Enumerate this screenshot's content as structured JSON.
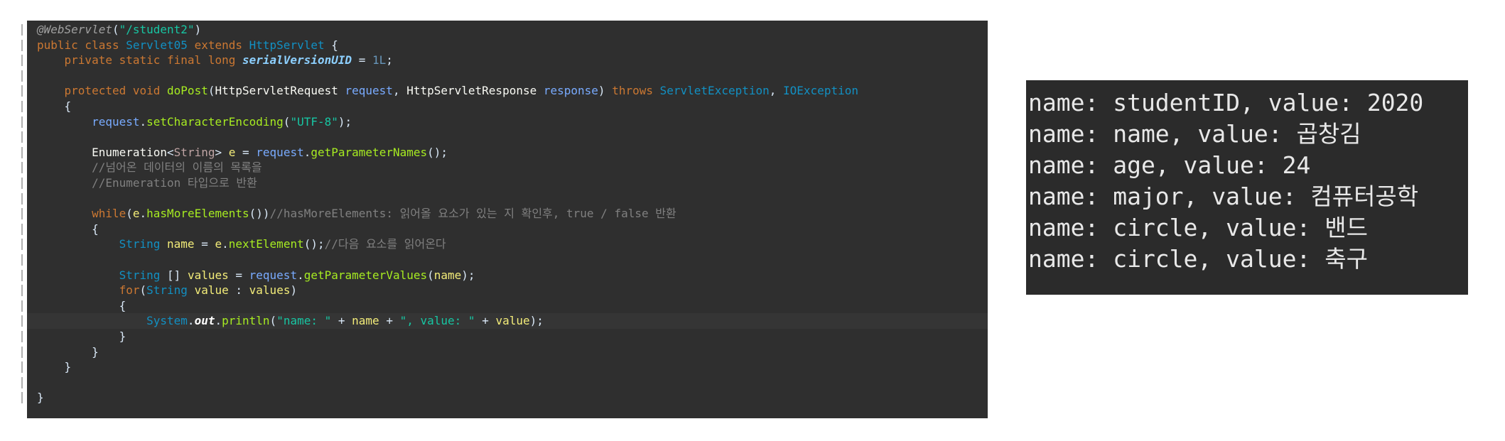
{
  "editor": {
    "lines": [
      {
        "segments": [
          {
            "c": "t-ann",
            "t": "@WebServlet"
          },
          {
            "c": "t-plain",
            "t": "("
          },
          {
            "c": "t-str",
            "t": "\"/student2\""
          },
          {
            "c": "t-plain",
            "t": ")"
          }
        ]
      },
      {
        "segments": [
          {
            "c": "t-kw",
            "t": "public class "
          },
          {
            "c": "t-cls",
            "t": "Servlet05"
          },
          {
            "c": "t-kw",
            "t": " extends "
          },
          {
            "c": "t-cls",
            "t": "HttpServlet"
          },
          {
            "c": "t-plain",
            "t": " {"
          }
        ]
      },
      {
        "segments": [
          {
            "c": "t-kw",
            "t": "    private static final long "
          },
          {
            "c": "t-field",
            "t": "serialVersionUID"
          },
          {
            "c": "t-plain",
            "t": " = "
          },
          {
            "c": "t-num",
            "t": "1L"
          },
          {
            "c": "t-plain",
            "t": ";"
          }
        ]
      },
      {
        "segments": []
      },
      {
        "segments": [
          {
            "c": "t-kw",
            "t": "    protected void "
          },
          {
            "c": "t-meth",
            "t": "doPost"
          },
          {
            "c": "t-plain",
            "t": "("
          },
          {
            "c": "t-type",
            "t": "HttpServletRequest "
          },
          {
            "c": "t-param",
            "t": "request"
          },
          {
            "c": "t-plain",
            "t": ", "
          },
          {
            "c": "t-type",
            "t": "HttpServletResponse "
          },
          {
            "c": "t-param",
            "t": "response"
          },
          {
            "c": "t-plain",
            "t": ") "
          },
          {
            "c": "t-kw",
            "t": "throws "
          },
          {
            "c": "t-cls",
            "t": "ServletException"
          },
          {
            "c": "t-plain",
            "t": ", "
          },
          {
            "c": "t-cls",
            "t": "IOException"
          }
        ]
      },
      {
        "segments": [
          {
            "c": "t-plain",
            "t": "    {"
          }
        ]
      },
      {
        "segments": [
          {
            "c": "t-param",
            "t": "        request"
          },
          {
            "c": "t-plain",
            "t": "."
          },
          {
            "c": "t-mcall",
            "t": "setCharacterEncoding"
          },
          {
            "c": "t-plain",
            "t": "("
          },
          {
            "c": "t-str",
            "t": "\"UTF-8\""
          },
          {
            "c": "t-plain",
            "t": ");"
          }
        ]
      },
      {
        "segments": []
      },
      {
        "segments": [
          {
            "c": "t-type",
            "t": "        Enumeration"
          },
          {
            "c": "t-plain",
            "t": "<"
          },
          {
            "c": "t-gen",
            "t": "String"
          },
          {
            "c": "t-plain",
            "t": "> "
          },
          {
            "c": "t-var",
            "t": "e"
          },
          {
            "c": "t-plain",
            "t": " = "
          },
          {
            "c": "t-param",
            "t": "request"
          },
          {
            "c": "t-plain",
            "t": "."
          },
          {
            "c": "t-mcall",
            "t": "getParameterNames"
          },
          {
            "c": "t-plain",
            "t": "();"
          }
        ]
      },
      {
        "segments": [
          {
            "c": "t-com",
            "t": "        //넘어온 데이터의 이름의 목록을"
          }
        ]
      },
      {
        "segments": [
          {
            "c": "t-com",
            "t": "        //Enumeration 타입으로 반환"
          }
        ]
      },
      {
        "segments": []
      },
      {
        "segments": [
          {
            "c": "t-kw",
            "t": "        while"
          },
          {
            "c": "t-plain",
            "t": "("
          },
          {
            "c": "t-var",
            "t": "e"
          },
          {
            "c": "t-plain",
            "t": "."
          },
          {
            "c": "t-mcall",
            "t": "hasMoreElements"
          },
          {
            "c": "t-plain",
            "t": "())"
          },
          {
            "c": "t-com",
            "t": "//hasMoreElements: 읽어올 요소가 있는 지 확인후, true / false 반환"
          }
        ]
      },
      {
        "segments": [
          {
            "c": "t-plain",
            "t": "        {"
          }
        ]
      },
      {
        "segments": [
          {
            "c": "t-cls",
            "t": "            String "
          },
          {
            "c": "t-var",
            "t": "name"
          },
          {
            "c": "t-plain",
            "t": " = "
          },
          {
            "c": "t-var",
            "t": "e"
          },
          {
            "c": "t-plain",
            "t": "."
          },
          {
            "c": "t-mcall",
            "t": "nextElement"
          },
          {
            "c": "t-plain",
            "t": "();"
          },
          {
            "c": "t-com",
            "t": "//다음 요소를 읽어온다"
          }
        ]
      },
      {
        "segments": []
      },
      {
        "segments": [
          {
            "c": "t-cls",
            "t": "            String "
          },
          {
            "c": "t-plain",
            "t": "[] "
          },
          {
            "c": "t-var",
            "t": "values"
          },
          {
            "c": "t-plain",
            "t": " = "
          },
          {
            "c": "t-param",
            "t": "request"
          },
          {
            "c": "t-plain",
            "t": "."
          },
          {
            "c": "t-mcall",
            "t": "getParameterValues"
          },
          {
            "c": "t-plain",
            "t": "("
          },
          {
            "c": "t-var",
            "t": "name"
          },
          {
            "c": "t-plain",
            "t": ");"
          }
        ]
      },
      {
        "segments": [
          {
            "c": "t-kw",
            "t": "            for"
          },
          {
            "c": "t-plain",
            "t": "("
          },
          {
            "c": "t-cls",
            "t": "String "
          },
          {
            "c": "t-var",
            "t": "value"
          },
          {
            "c": "t-plain",
            "t": " : "
          },
          {
            "c": "t-var",
            "t": "values"
          },
          {
            "c": "t-plain",
            "t": ")"
          }
        ]
      },
      {
        "segments": [
          {
            "c": "t-plain",
            "t": "            {"
          }
        ]
      },
      {
        "segments": [
          {
            "c": "t-cls",
            "t": "                System"
          },
          {
            "c": "t-plain",
            "t": "."
          },
          {
            "c": "t-static",
            "t": "out"
          },
          {
            "c": "t-plain",
            "t": "."
          },
          {
            "c": "t-mcall",
            "t": "println"
          },
          {
            "c": "t-plain",
            "t": "("
          },
          {
            "c": "t-str",
            "t": "\"name: \""
          },
          {
            "c": "t-plain",
            "t": " + "
          },
          {
            "c": "t-var",
            "t": "name"
          },
          {
            "c": "t-plain",
            "t": " + "
          },
          {
            "c": "t-str",
            "t": "\", value: \""
          },
          {
            "c": "t-plain",
            "t": " + "
          },
          {
            "c": "t-var",
            "t": "value"
          },
          {
            "c": "t-plain",
            "t": ");"
          }
        ],
        "highlight": true
      },
      {
        "segments": [
          {
            "c": "t-plain",
            "t": "            }"
          }
        ]
      },
      {
        "segments": [
          {
            "c": "t-plain",
            "t": "        }"
          }
        ]
      },
      {
        "segments": [
          {
            "c": "t-plain",
            "t": "    }"
          }
        ]
      },
      {
        "segments": []
      },
      {
        "segments": [
          {
            "c": "t-plain",
            "t": "}"
          }
        ]
      }
    ]
  },
  "console": {
    "lines": [
      "name: studentID, value: 2020",
      "name: name, value: 곱창김",
      "name: age, value: 24",
      "name: major, value: 컴퓨터공학",
      "name: circle, value: 밴드",
      "name: circle, value: 축구"
    ]
  }
}
